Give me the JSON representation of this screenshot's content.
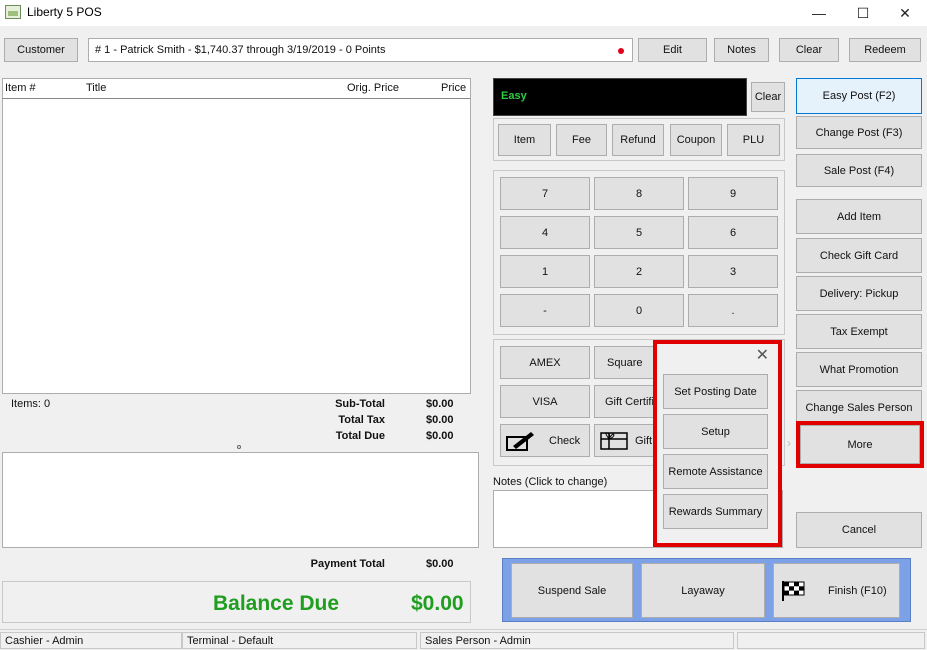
{
  "window": {
    "title": "Liberty 5 POS",
    "minimize": "—",
    "maximize": "☐",
    "close": "✕"
  },
  "header": {
    "customer_button": "Customer",
    "customer_info": "# 1 - Patrick Smith -  $1,740.37 through 3/19/2019 - 0 Points",
    "edit_button": "Edit",
    "notes_button": "Notes",
    "clear_button": "Clear",
    "redeem_button": "Redeem"
  },
  "items_table": {
    "columns": [
      "Item #",
      "Title",
      "Orig. Price",
      "Price"
    ],
    "rows": []
  },
  "totals": {
    "items_count": "Items: 0",
    "subtotal_label": "Sub-Total",
    "subtotal_value": "$0.00",
    "tax_label": "Total Tax",
    "tax_value": "$0.00",
    "due_label": "Total Due",
    "due_value": "$0.00",
    "payment_total_label": "Payment Total",
    "payment_total_value": "$0.00",
    "balance_due_label": "Balance Due",
    "balance_due_value": "$0.00"
  },
  "entry": {
    "display_text": "Easy",
    "clear_button": "Clear",
    "modes": [
      "Item",
      "Fee",
      "Refund",
      "Coupon",
      "PLU"
    ]
  },
  "keypad": [
    "7",
    "8",
    "9",
    "4",
    "5",
    "6",
    "1",
    "2",
    "3",
    "-",
    "0",
    "."
  ],
  "tenders": {
    "amex": "AMEX",
    "square": "Square",
    "visa": "VISA",
    "gift_certificate": "Gift Certifi",
    "check": "Check",
    "gift": "Gift"
  },
  "notes_label": "Notes (Click to change)",
  "popup_menu": {
    "items": [
      "Set Posting Date",
      "Setup",
      "Remote Assistance",
      "Rewards Summary"
    ]
  },
  "right_panel": {
    "easy_post": "Easy Post (F2)",
    "change_post": "Change Post (F3)",
    "sale_post": "Sale Post (F4)",
    "add_item": "Add Item",
    "check_gift_card": "Check Gift Card",
    "delivery": "Delivery: Pickup",
    "tax_exempt": "Tax Exempt",
    "what_promotion": "What Promotion",
    "change_sales_person": "Change Sales Person",
    "more": "More",
    "cancel": "Cancel"
  },
  "actions": {
    "suspend_sale": "Suspend Sale",
    "layaway": "Layaway",
    "finish": "Finish (F10)"
  },
  "statusbar": {
    "cashier": "Cashier - Admin",
    "terminal": "Terminal - Default",
    "sales_person": "Sales Person - Admin"
  },
  "colors": {
    "accent_blue": "#0078d7",
    "balance_green": "#1f9e1f",
    "highlight_red": "#e00000",
    "easy_green": "#2ecc40",
    "action_bar_blue": "#7da1e6"
  }
}
